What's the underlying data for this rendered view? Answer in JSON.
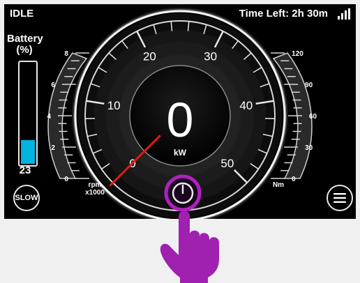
{
  "status": {
    "mode": "IDLE",
    "time_left": "Time Left: 2h 30m",
    "signal_icon": "signal-icon"
  },
  "battery": {
    "title_line1": "Battery",
    "title_line2": "(%)",
    "value": "23",
    "level_percent": 23,
    "fill_color": "#00b4e0"
  },
  "gauge": {
    "readout": "0",
    "unit": "kW",
    "power_ticks": [
      "0",
      "10",
      "20",
      "30",
      "40",
      "50"
    ],
    "needle_value": 0,
    "needle_color": "#e01818"
  },
  "rpm_scale": {
    "ticks": [
      "0",
      "2",
      "4",
      "6",
      "8"
    ],
    "label_line1": "rpm",
    "label_line2": "x1000"
  },
  "torque_scale": {
    "ticks": [
      "0",
      "30",
      "60",
      "90",
      "120"
    ],
    "label": "Nm"
  },
  "buttons": {
    "slow_label": "SLOW",
    "menu_icon": "hamburger-menu-icon",
    "power_icon": "power-icon"
  },
  "overlay": {
    "hand_icon": "pointing-hand-icon",
    "accent": "#a020b0"
  }
}
